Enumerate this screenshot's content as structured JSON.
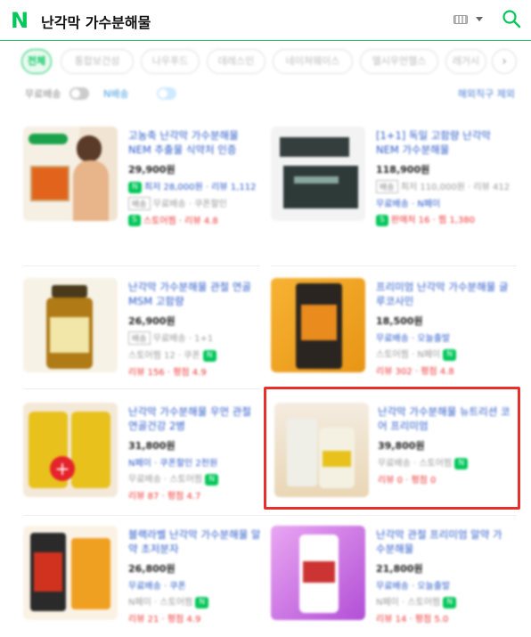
{
  "header": {
    "logo": "N",
    "query": "난각막 가수분해물"
  },
  "chips": [
    "전체",
    "통합보건성",
    "나우푸드",
    "데레스인",
    "네이쳐웨이스",
    "엘시우먼헬스",
    "레거시"
  ],
  "options": {
    "left_label_1": "무료배송",
    "left_label_2": "N배송",
    "right_link": "해외직구 제외"
  },
  "products": [
    {
      "title": "고농축 난각막 가수분해물 NEM 추출물 식약처 인증",
      "price": "29,900원",
      "meta1": "최저 28,000원 · 리뷰 1,112",
      "meta2": "무료배송 · 쿠폰할인",
      "meta3": "스토어찜 · 리뷰 4.8"
    },
    {
      "title": "[1+1] 독일 고함량 난각막 NEM 가수분해물",
      "price": "118,900원",
      "meta1": "최저 110,000원 · 리뷰 412",
      "meta2": "무료배송 · N페이",
      "meta3": "판매처 16 · 찜 1,380"
    },
    {
      "title": "난각막 가수분해물 관절 연골 MSM 고함량",
      "price": "26,900원",
      "meta1": "무료배송 · 1+1",
      "meta2": "스토어찜 12 · 쿠폰",
      "meta3": "리뷰 156 · 평점 4.9"
    },
    {
      "title": "프리미엄 난각막 가수분해물 글루코사민",
      "price": "18,500원",
      "meta1": "무료배송 · 오늘출발",
      "meta2": "스토어찜 · N페이",
      "meta3": "리뷰 302 · 평점 4.8"
    },
    {
      "title": "난각막 가수분해물 우먼 관절 연골건강 2병",
      "price": "31,800원",
      "meta1": "N페이 · 쿠폰할인 2천원",
      "meta2": "무료배송 · 스토어찜",
      "meta3": "리뷰 87 · 평점 4.7"
    },
    {
      "title": "난각막 가수분해물 뉴트리션 코어 프리미엄",
      "price": "39,800원",
      "meta1": "무료배송 · 스토어찜",
      "meta2": "리뷰 0 · 평점 0",
      "meta3": ""
    },
    {
      "title": "블랙라벨 난각막 가수분해물 알약 초저분자",
      "price": "26,800원",
      "meta1": "무료배송 · 쿠폰",
      "meta2": "N페이 · 스토어찜",
      "meta3": "리뷰 21 · 평점 4.9"
    },
    {
      "title": "난각막 관절 프리미엄 알약 가수분해물",
      "price": "21,800원",
      "meta1": "무료배송 · 오늘출발",
      "meta2": "N페이 · 스토어찜",
      "meta3": "리뷰 14 · 평점 5.0"
    }
  ]
}
